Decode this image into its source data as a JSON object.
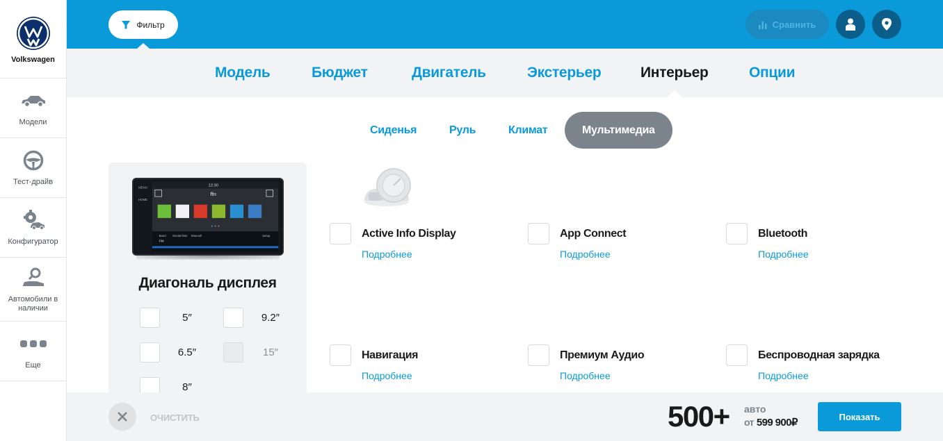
{
  "brand": {
    "name": "Volkswagen"
  },
  "sidebar": {
    "items": [
      {
        "label": "Модели",
        "icon": "car-icon"
      },
      {
        "label": "Тест-драйв",
        "icon": "steering-wheel-icon"
      },
      {
        "label": "Конфигуратор",
        "icon": "configurator-icon"
      },
      {
        "label": "Автомобили в наличии",
        "icon": "car-search-icon"
      },
      {
        "label": "Еще",
        "icon": "more-dots-icon"
      }
    ]
  },
  "topbar": {
    "filter_label": "Фильтр",
    "compare_label": "Сравнить",
    "accent": "#0a9ad9"
  },
  "category_tabs": [
    "Модель",
    "Бюджет",
    "Двигатель",
    "Экстерьер",
    "Интерьер",
    "Опции"
  ],
  "active_category": "Интерьер",
  "sub_tabs": [
    "Сиденья",
    "Руль",
    "Климат",
    "Мультимедиа"
  ],
  "active_sub_tab": "Мультимедиа",
  "display_panel": {
    "title": "Диагональ дисплея",
    "screen": {
      "time": "12:30",
      "station": "ffn",
      "menu_items": [
        "MENU",
        "HOME"
      ],
      "bottom_labels": [
        "Band",
        "FM",
        "Senderliste",
        "Manuell",
        "Setup"
      ]
    },
    "sizes": [
      {
        "label": "5″",
        "enabled": true
      },
      {
        "label": "9.2″",
        "enabled": true
      },
      {
        "label": "6.5″",
        "enabled": true
      },
      {
        "label": "15″",
        "enabled": false
      },
      {
        "label": "8″",
        "enabled": true
      }
    ]
  },
  "options": [
    {
      "name": "Active Info Display",
      "more": "Подробнее"
    },
    {
      "name": "App Connect",
      "more": "Подробнее"
    },
    {
      "name": "Bluetooth",
      "more": "Подробнее"
    },
    {
      "name": "Навигация",
      "more": "Подробнее"
    },
    {
      "name": "Премиум Аудио",
      "more": "Подробнее"
    },
    {
      "name": "Беспроводная зарядка",
      "more": "Подробнее"
    }
  ],
  "bottombar": {
    "clear_label": "ОЧИСТИТЬ",
    "count": "500+",
    "count_unit": "авто",
    "price_prefix": "от",
    "price": "599 900₽",
    "show_label": "Показать"
  }
}
